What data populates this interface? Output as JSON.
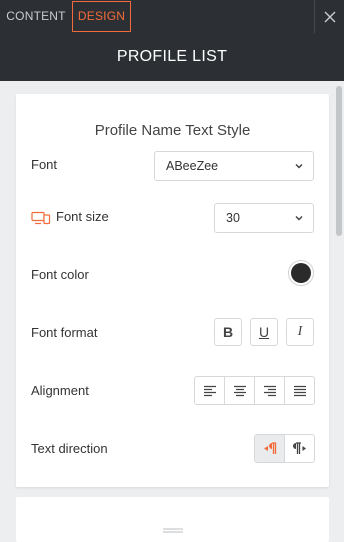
{
  "tabs": [
    {
      "label": "CONTENT",
      "active": false
    },
    {
      "label": "DESIGN",
      "active": true
    }
  ],
  "header": {
    "title": "PROFILE LIST"
  },
  "section": {
    "title": "Profile Name Text Style",
    "font": {
      "label": "Font",
      "value": "ABeeZee"
    },
    "font_size": {
      "label": "Font size",
      "value": "30",
      "icon": "devices-icon"
    },
    "font_color": {
      "label": "Font color",
      "value": "#2b2b2b"
    },
    "font_format": {
      "label": "Font format",
      "buttons": [
        "B",
        "U",
        "I"
      ]
    },
    "alignment": {
      "label": "Alignment",
      "options": [
        "left",
        "center",
        "right",
        "justify"
      ]
    },
    "text_direction": {
      "label": "Text direction",
      "options": [
        "rtl",
        "ltr"
      ],
      "selected": "rtl"
    }
  },
  "colors": {
    "accent": "#f36b3a",
    "header_bg": "#2c3034",
    "panel_bg": "#ffffff",
    "page_bg": "#eceeef"
  }
}
